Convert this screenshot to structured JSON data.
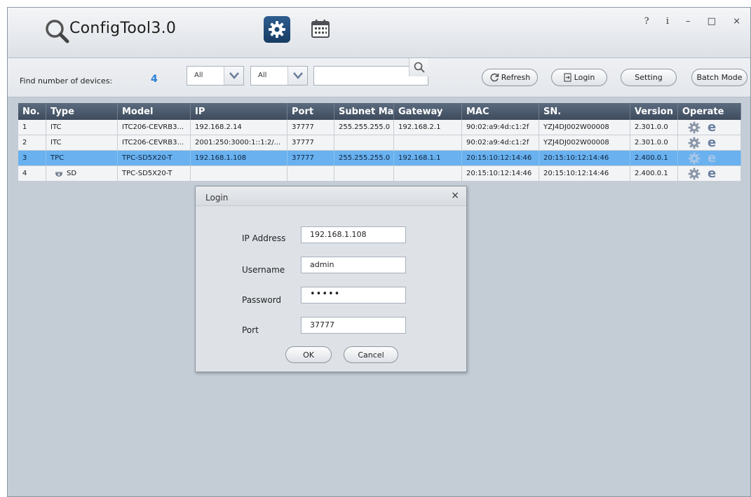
{
  "app": {
    "title": "ConfigTool3.0",
    "window_controls": "? i – □ ×"
  },
  "toolbar": {
    "find_label": "Find number of devices:",
    "device_count": "4",
    "filter1_value": "All",
    "filter2_value": "All",
    "search_value": "",
    "refresh_label": "Refresh",
    "login_label": "Login",
    "setting_label": "Setting",
    "batch_mode_label": "Batch Mode"
  },
  "table": {
    "headers": [
      "No.",
      "Type",
      "Model",
      "IP",
      "Port",
      "Subnet Mask",
      "Gateway",
      "MAC",
      "SN.",
      "Version",
      "Operate"
    ],
    "rows": [
      {
        "no": "1",
        "type": "ITC",
        "model": "ITC206-CEVRB3...",
        "ip": "192.168.2.14",
        "port": "37777",
        "mask": "255.255.255.0",
        "gateway": "192.168.2.1",
        "mac": "90:02:a9:4d:c1:2f",
        "sn": "YZJ4DJ002W00008",
        "version": "2.301.0.0"
      },
      {
        "no": "2",
        "type": "ITC",
        "model": "ITC206-CEVRB3...",
        "ip": "2001:250:3000:1::1:2/...",
        "port": "37777",
        "mask": "",
        "gateway": "",
        "mac": "90:02:a9:4d:c1:2f",
        "sn": "YZJ4DJ002W00008",
        "version": "2.301.0.0"
      },
      {
        "no": "3",
        "type": "TPC",
        "model": "TPC-SD5X20-T",
        "ip": "192.168.1.108",
        "port": "37777",
        "mask": "255.255.255.0",
        "gateway": "192.168.1.1",
        "mac": "20:15:10:12:14:46",
        "sn": "20:15:10:12:14:46",
        "version": "2.400.0.1"
      },
      {
        "no": "4",
        "type": "SD",
        "model": "TPC-SD5X20-T",
        "ip": "",
        "port": "",
        "mask": "",
        "gateway": "",
        "mac": "20:15:10:12:14:46",
        "sn": "20:15:10:12:14:46",
        "version": "2.400.0.1"
      }
    ]
  },
  "dialog": {
    "title": "Login",
    "close": "×",
    "ip_label": "IP Address",
    "ip_value": "192.168.1.108",
    "username_label": "Username",
    "username_value": "admin",
    "password_label": "Password",
    "password_value": "•••••",
    "port_label": "Port",
    "port_value": "37777",
    "ok_label": "OK",
    "cancel_label": "Cancel"
  },
  "colors": {
    "accent": "#2b7fd6",
    "selected_row": "#69b1ef",
    "header_bg": "#4a596c"
  }
}
